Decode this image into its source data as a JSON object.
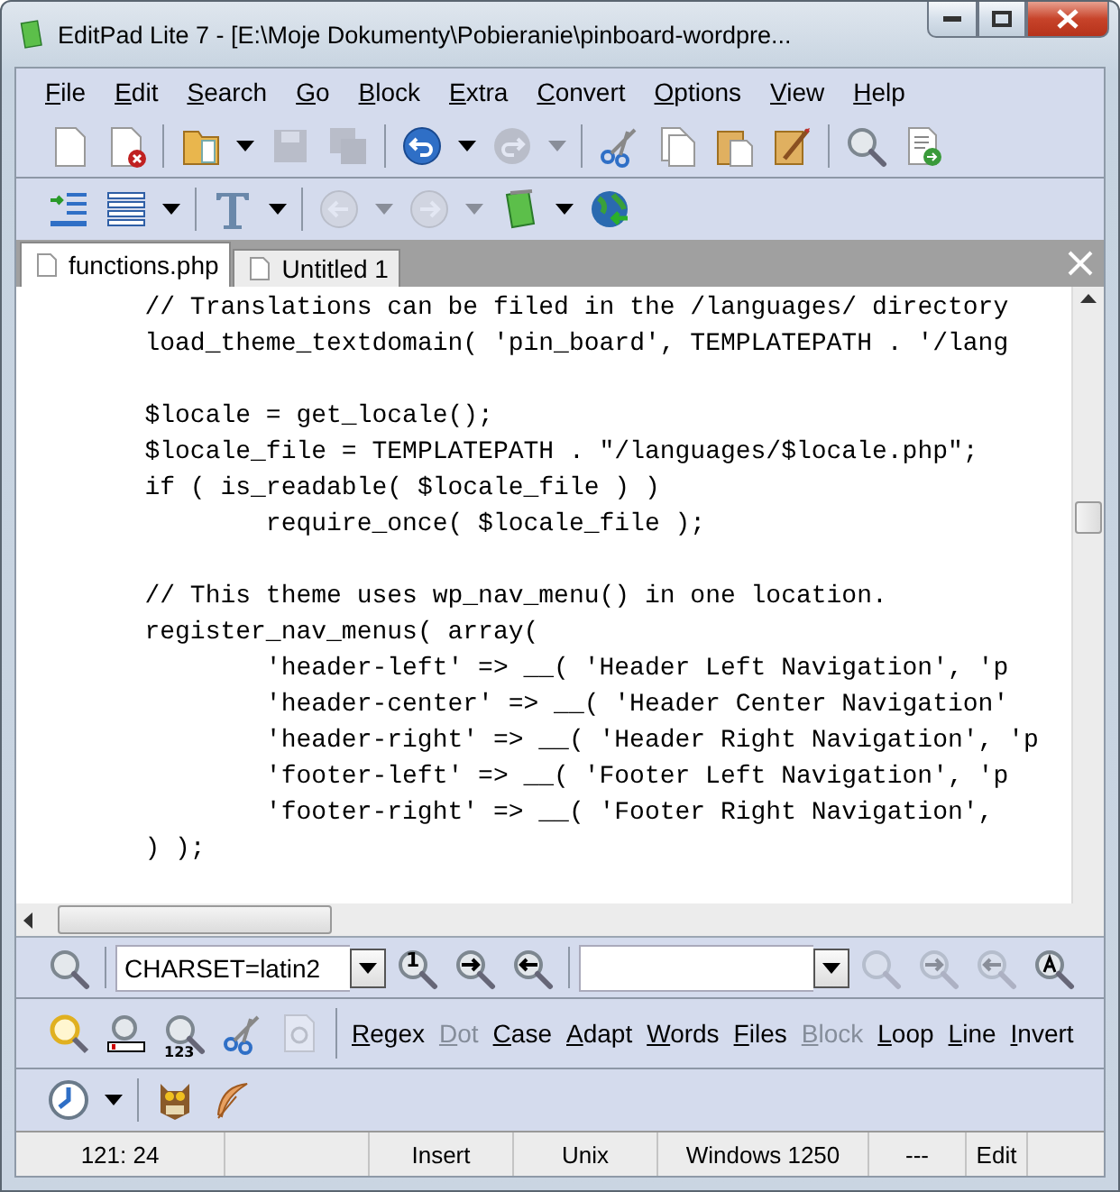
{
  "window": {
    "title": "EditPad Lite 7 - [E:\\Moje Dokumenty\\Pobieranie\\pinboard-wordpre..."
  },
  "menu": [
    "File",
    "Edit",
    "Search",
    "Go",
    "Block",
    "Extra",
    "Convert",
    "Options",
    "View",
    "Help"
  ],
  "toolbar_1": [
    {
      "kind": "new-file",
      "disabled": false,
      "dropdown": false
    },
    {
      "kind": "close-file",
      "disabled": false,
      "dropdown": false
    },
    {
      "kind": "separator"
    },
    {
      "kind": "open-folder",
      "disabled": false,
      "dropdown": true
    },
    {
      "kind": "save",
      "disabled": true,
      "dropdown": false
    },
    {
      "kind": "save-all",
      "disabled": true,
      "dropdown": false
    },
    {
      "kind": "separator"
    },
    {
      "kind": "undo",
      "disabled": false,
      "dropdown": true
    },
    {
      "kind": "redo",
      "disabled": true,
      "dropdown": true
    },
    {
      "kind": "separator"
    },
    {
      "kind": "cut",
      "disabled": false,
      "dropdown": false
    },
    {
      "kind": "copy",
      "disabled": false,
      "dropdown": false
    },
    {
      "kind": "paste",
      "disabled": false,
      "dropdown": false
    },
    {
      "kind": "paste-edit",
      "disabled": false,
      "dropdown": false
    },
    {
      "kind": "separator"
    },
    {
      "kind": "search",
      "disabled": false,
      "dropdown": false
    },
    {
      "kind": "file-arrow",
      "disabled": false,
      "dropdown": false
    }
  ],
  "toolbar_2": [
    {
      "kind": "indent",
      "disabled": false,
      "dropdown": false
    },
    {
      "kind": "lines",
      "disabled": false,
      "dropdown": true
    },
    {
      "kind": "separator"
    },
    {
      "kind": "font",
      "disabled": false,
      "dropdown": true
    },
    {
      "kind": "separator"
    },
    {
      "kind": "back",
      "disabled": true,
      "dropdown": true
    },
    {
      "kind": "forward",
      "disabled": true,
      "dropdown": true
    },
    {
      "kind": "notepad",
      "disabled": false,
      "dropdown": true
    },
    {
      "kind": "globe",
      "disabled": false,
      "dropdown": false
    }
  ],
  "tabs": [
    {
      "label": "functions.php",
      "selected": true
    },
    {
      "label": "Untitled 1",
      "selected": false
    }
  ],
  "code_lines": [
    {
      "kind": "code",
      "text": "\t// Translations can be filed in the /languages/ directory"
    },
    {
      "kind": "code",
      "text": "\tload_theme_textdomain( 'pin_board', TEMPLATEPATH . '/lang"
    },
    {
      "kind": "blank"
    },
    {
      "kind": "code",
      "text": "\t$locale = get_locale();"
    },
    {
      "kind": "code",
      "text": "\t$locale_file = TEMPLATEPATH . \"/languages/$locale.php\";"
    },
    {
      "kind": "code",
      "text": "\tif ( is_readable( $locale_file ) )"
    },
    {
      "kind": "code",
      "text": "\t\trequire_once( $locale_file );"
    },
    {
      "kind": "blank"
    },
    {
      "kind": "code",
      "text": "\t// This theme uses wp_nav_menu() in one location."
    },
    {
      "kind": "code",
      "text": "\tregister_nav_menus( array("
    },
    {
      "kind": "code",
      "text": "\t\t'header-left' => __( 'Header Left Navigation', 'p"
    },
    {
      "kind": "code",
      "text": "\t\t'header-center' => __( 'Header Center Navigation'"
    },
    {
      "kind": "code",
      "text": "\t\t'header-right' => __( 'Header Right Navigation', 'p"
    },
    {
      "kind": "code",
      "text": "\t\t'footer-left' => __( 'Footer Left Navigation', 'p"
    },
    {
      "kind": "code",
      "text": "\t\t'footer-right' => __( 'Footer Right Navigation',"
    },
    {
      "kind": "code",
      "text": "\t) );"
    }
  ],
  "search_bar": {
    "search_value": "CHARSET=latin2",
    "search_tools": [
      {
        "kind": "search",
        "disabled": false
      },
      {
        "kind": "find-first",
        "disabled": false,
        "label": "1"
      },
      {
        "kind": "find-next",
        "disabled": false
      },
      {
        "kind": "find-prev",
        "disabled": false
      }
    ],
    "replace_tools": [
      {
        "kind": "replace",
        "disabled": true
      },
      {
        "kind": "replace-next",
        "disabled": true
      },
      {
        "kind": "replace-prev",
        "disabled": true
      },
      {
        "kind": "replace-all",
        "disabled": false
      }
    ],
    "action_tools": [
      {
        "kind": "highlight",
        "disabled": false
      },
      {
        "kind": "search-bar",
        "disabled": false
      },
      {
        "kind": "search-count",
        "disabled": false,
        "label": "123"
      },
      {
        "kind": "cut",
        "disabled": false
      },
      {
        "kind": "page-search",
        "disabled": true
      }
    ],
    "options": [
      {
        "label": "Regex",
        "disabled": false
      },
      {
        "label": "Dot",
        "disabled": true
      },
      {
        "label": "Case",
        "disabled": false
      },
      {
        "label": "Adapt",
        "disabled": false
      },
      {
        "label": "Words",
        "disabled": false
      },
      {
        "label": "Files",
        "disabled": false
      },
      {
        "label": "Block",
        "disabled": true
      },
      {
        "label": "Loop",
        "disabled": false
      },
      {
        "label": "Line",
        "disabled": false
      },
      {
        "label": "Invert",
        "disabled": false
      }
    ],
    "history_tools": [
      {
        "kind": "clock",
        "disabled": false,
        "dropdown": true
      },
      {
        "kind": "separator"
      },
      {
        "kind": "owl",
        "disabled": false,
        "dropdown": false
      },
      {
        "kind": "feather",
        "disabled": false,
        "dropdown": false
      }
    ]
  },
  "status_bar": [
    "121: 24",
    "Insert",
    "Unix",
    "Windows 1250",
    "---",
    "Edit"
  ]
}
